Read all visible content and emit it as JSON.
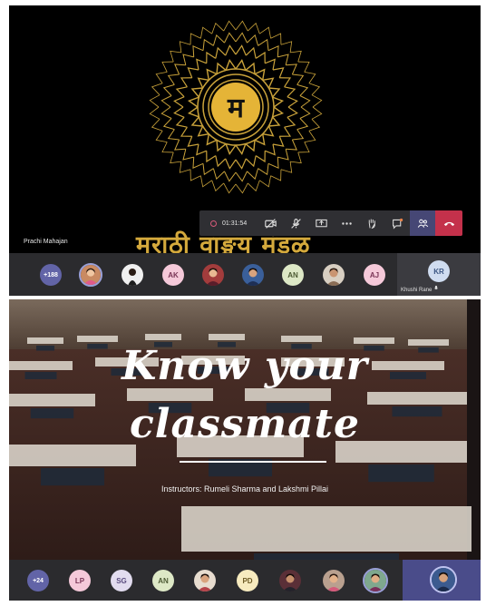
{
  "meeting_1": {
    "banner_text": "मराठी वाङ्मय मंडळ",
    "logo_letter": "म",
    "speaker_name": "Prachi Mahajan",
    "call_duration": "01:31:54",
    "controls": [
      "camera-icon",
      "mic-off-icon",
      "share-screen-icon",
      "more-icon",
      "raise-hand-icon",
      "chat-icon",
      "participants-icon",
      "hang-up-icon"
    ],
    "participants_overflow": "+188",
    "participant_initials": [
      "AK",
      "AN",
      "AJ"
    ],
    "pinned_initials": "KR",
    "pinned_name": "Khushi Rane"
  },
  "meeting_2": {
    "title_line1": "Know your",
    "title_line2": "classmate",
    "instructors": "Instructors: Rumeli Sharma and Lakshmi Pillai",
    "participants_overflow": "+24",
    "participant_initials": [
      "LP",
      "SG",
      "AN",
      "PD"
    ]
  },
  "colors": {
    "teams_purple": "#6264a7",
    "hang_up_red": "#c4314b",
    "gold": "#d4a93c"
  }
}
